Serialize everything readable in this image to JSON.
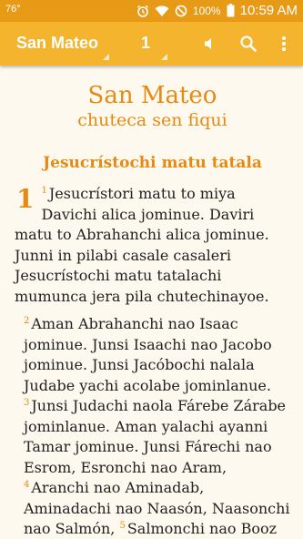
{
  "status_bar": {
    "temperature": "76°",
    "battery": "100%",
    "time": "10:59 AM"
  },
  "app_bar": {
    "book": "San Mateo",
    "chapter": "1",
    "icons": [
      "volume-icon",
      "search-icon",
      "more-vert-icon"
    ]
  },
  "content": {
    "book_title": "San Mateo",
    "book_subtitle": "chuteca sen fiqui",
    "section_heading": "Jesucrístochi matu tatala",
    "chapter_number": "1",
    "verses": [
      {
        "n": "1",
        "text": "Jesucrístori matu to miya Davichi alica jominue. Daviri matu to Abrahanchi alica jominue. Junni in pilabi casale casaleri Jesucrístochi matu tatalachi mumunca jera pila chutechinayoe."
      },
      {
        "n": "2",
        "text": "Aman Abrahanchi nao Isaac jominue. Junsi Isaachi nao Jacobo jominue. Junsi Jacóbochi nalala Judabe yachi acolabe jominlanue."
      },
      {
        "n": "3",
        "text": "Junsi Judachi naola Fárebe Zárabe jominlanue. Aman yalachi ayanni Tamar jominue. Junsi Fárechi nao Esrom, Esronchi nao Aram,"
      },
      {
        "n": "4",
        "text": "Aranchi nao Aminadab, Aminadachi nao Naasón, Naasonchi nao Salmón,"
      },
      {
        "n": "5",
        "text": "Salmonchi nao Booz"
      }
    ]
  },
  "colors": {
    "status_bar": "#e79a16",
    "app_bar": "#f4b42e",
    "accent": "#e68a13",
    "background": "#fdf9ef"
  }
}
